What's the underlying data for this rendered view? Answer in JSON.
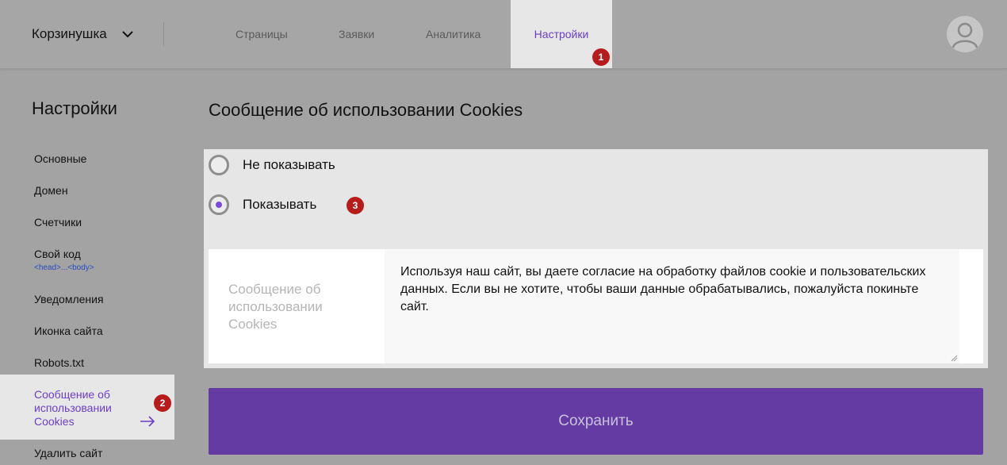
{
  "header": {
    "brand": "Корзинушка",
    "tabs": [
      {
        "label": "Страницы"
      },
      {
        "label": "Заявки"
      },
      {
        "label": "Аналитика"
      },
      {
        "label": "Настройки",
        "active": true
      }
    ]
  },
  "badges": {
    "b1": "1",
    "b2": "2",
    "b3": "3"
  },
  "sidebar": {
    "title": "Настройки",
    "items": [
      {
        "label": "Основные"
      },
      {
        "label": "Домен"
      },
      {
        "label": "Счетчики"
      },
      {
        "label": "Свой код",
        "sub": "<head>...<body>"
      },
      {
        "label": "Уведомления"
      },
      {
        "label": "Иконка сайта"
      },
      {
        "label": "Robots.txt"
      },
      {
        "label": "Сообщение об использовании Cookies",
        "active": true
      },
      {
        "label": "Удалить сайт"
      }
    ]
  },
  "main": {
    "title": "Сообщение об использовании Cookies",
    "options": [
      {
        "label": "Не показывать",
        "checked": false
      },
      {
        "label": "Показывать",
        "checked": true
      }
    ],
    "message_label": "Сообщение об использовании Cookies",
    "message_text": "Используя наш сайт, вы даете согласие на обработку файлов cookie и пользовательских данных. Если вы не хотите, чтобы ваши данные обрабатывались, пожалуйста покиньте сайт.",
    "save_label": "Сохранить"
  },
  "colors": {
    "accent": "#633ba3",
    "active_link": "#6a3fc4",
    "badge": "#b71c1c"
  }
}
